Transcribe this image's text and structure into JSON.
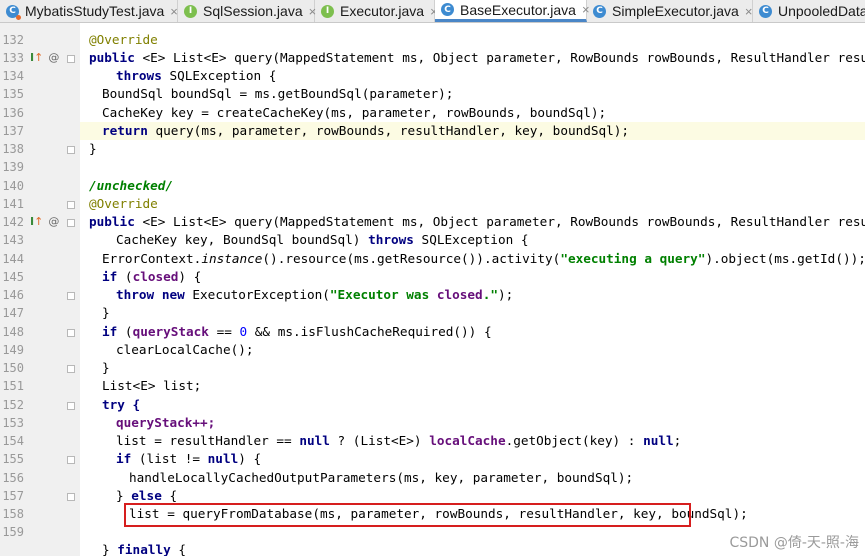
{
  "tabs": [
    {
      "label": "MybatisStudyTest.java",
      "icon": "class-icon",
      "active": false
    },
    {
      "label": "SqlSession.java",
      "icon": "interface-icon",
      "active": false
    },
    {
      "label": "Executor.java",
      "icon": "interface-icon",
      "active": false
    },
    {
      "label": "BaseExecutor.java",
      "icon": "class-icon",
      "active": true
    },
    {
      "label": "SimpleExecutor.java",
      "icon": "class-icon",
      "active": false
    },
    {
      "label": "UnpooledData",
      "icon": "class-icon",
      "active": false
    }
  ],
  "gutter": {
    "lines": [
      "132",
      "133",
      "134",
      "135",
      "136",
      "137",
      "138",
      "139",
      "140",
      "141",
      "142",
      "143",
      "144",
      "145",
      "146",
      "147",
      "148",
      "149",
      "150",
      "151",
      "152",
      "153",
      "154",
      "155",
      "156",
      "157",
      "158",
      "159"
    ],
    "markers": {
      "override_arrow": "↑",
      "at_symbol": "@",
      "impl_marker": "I"
    }
  },
  "code": {
    "l132": "@Override",
    "l133": "public <E> List<E> query(MappedStatement ms, Object parameter, RowBounds rowBounds, ResultHandler resultHandler)",
    "l134": "throws SQLException {",
    "l135": "BoundSql boundSql = ms.getBoundSql(parameter);",
    "l136": "CacheKey key = createCacheKey(ms, parameter, rowBounds, boundSql);",
    "l137": "return query(ms, parameter, rowBounds, resultHandler, key, boundSql);",
    "l138": "}",
    "l140": "/unchecked/",
    "l141": "@Override",
    "l142": "public <E> List<E> query(MappedStatement ms, Object parameter, RowBounds rowBounds, ResultHandler resultHandler,",
    "l143": "CacheKey key, BoundSql boundSql) throws SQLException {",
    "l144": "ErrorContext.instance().resource(ms.getResource()).activity(\"executing a query\").object(ms.getId());",
    "l145": "if (closed) {",
    "l146": "throw new ExecutorException(\"Executor was closed.\");",
    "l147": "}",
    "l148": "if (queryStack == 0 && ms.isFlushCacheRequired()) {",
    "l149": "clearLocalCache();",
    "l150": "}",
    "l151": "List<E> list;",
    "l152": "try {",
    "l153": "queryStack++;",
    "l154": "list = resultHandler == null ? (List<E>) localCache.getObject(key) : null;",
    "l155": "if (list != null) {",
    "l156": "handleLocallyCachedOutputParameters(ms, key, parameter, boundSql);",
    "l157": "} else {",
    "l158": "list = queryFromDatabase(ms, parameter, rowBounds, resultHandler, key, boundSql);",
    "l159": "} finally {"
  },
  "watermark": "CSDN @倚-天-照-海",
  "colors": {
    "keyword": "#000080",
    "annotation": "#808000",
    "string": "#008000",
    "field": "#660e7a",
    "highlight": "#d61e1e"
  }
}
